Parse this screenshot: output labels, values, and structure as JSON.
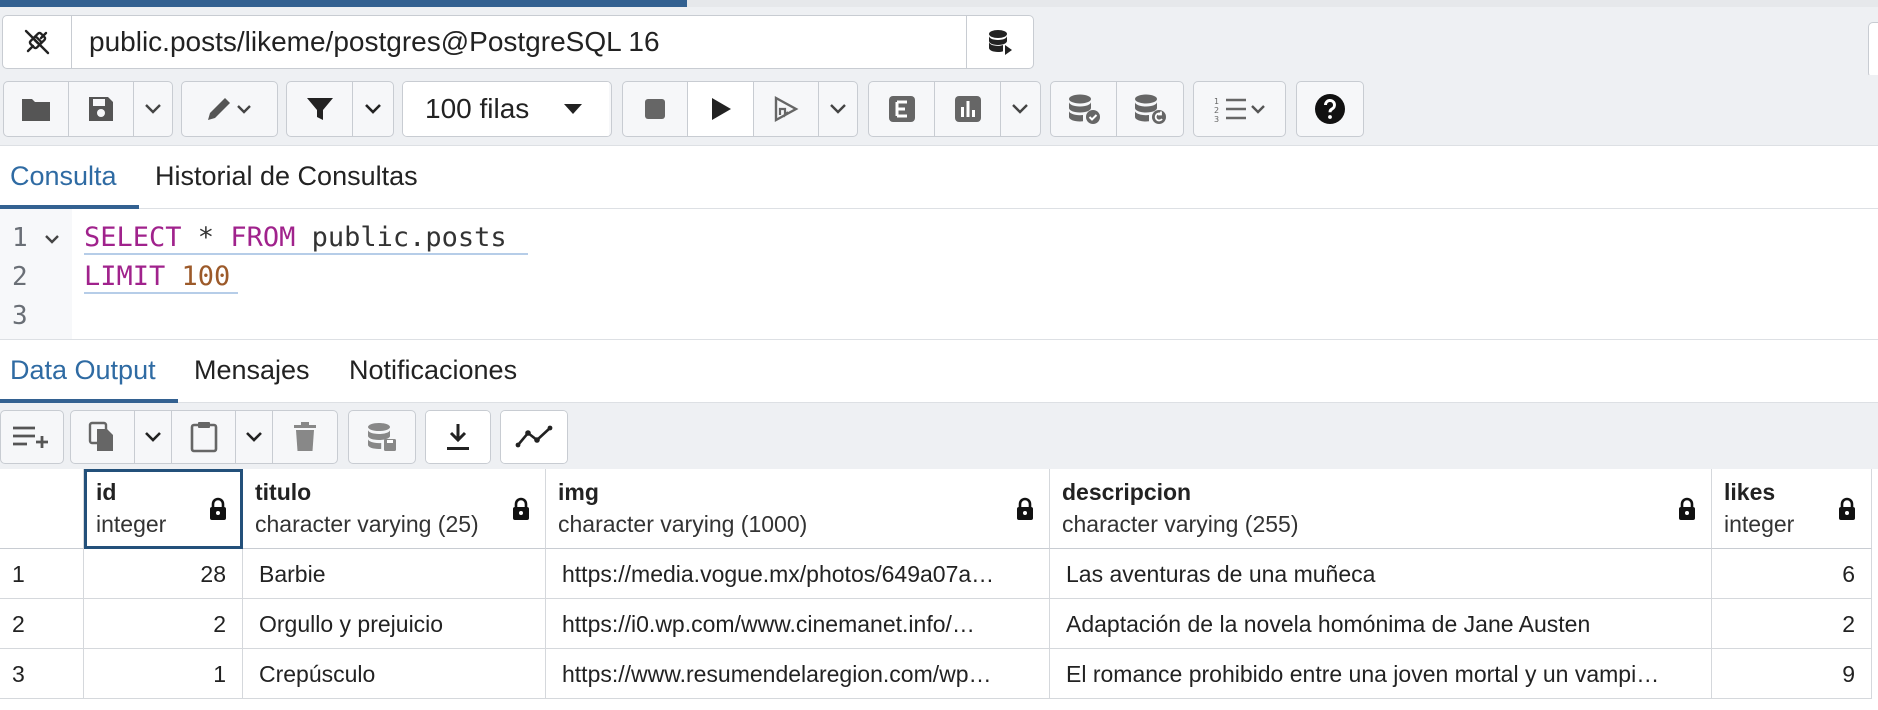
{
  "connection": {
    "label": "public.posts/likeme/postgres@PostgreSQL 16",
    "progress_fraction": 0.366
  },
  "toolbar": {
    "rows_limit_label": "100 filas"
  },
  "query_tabs": [
    {
      "label": "Consulta",
      "active": true
    },
    {
      "label": "Historial de Consultas",
      "active": false
    }
  ],
  "editor": {
    "line_numbers": [
      "1",
      "2",
      "3"
    ],
    "line1": {
      "kw1": "SELECT",
      "rest1": " * ",
      "kw2": "FROM",
      "rest2": " public.posts"
    },
    "line2": {
      "kw": "LIMIT",
      "num": " 100"
    }
  },
  "result_tabs": [
    {
      "label": "Data Output",
      "active": true
    },
    {
      "label": "Mensajes",
      "active": false
    },
    {
      "label": "Notificaciones",
      "active": false
    }
  ],
  "grid": {
    "columns": [
      {
        "name": "id",
        "type": "integer"
      },
      {
        "name": "titulo",
        "type": "character varying (25)"
      },
      {
        "name": "img",
        "type": "character varying (1000)"
      },
      {
        "name": "descripcion",
        "type": "character varying (255)"
      },
      {
        "name": "likes",
        "type": "integer"
      }
    ],
    "rows": [
      {
        "row": "1",
        "id": "28",
        "titulo": "Barbie",
        "img": "https://media.vogue.mx/photos/649a07a…",
        "descripcion": "Las aventuras de una muñeca",
        "likes": "6"
      },
      {
        "row": "2",
        "id": "2",
        "titulo": "Orgullo y prejuicio",
        "img": "https://i0.wp.com/www.cinemanet.info/…",
        "descripcion": "Adaptación de la novela homónima de Jane Austen",
        "likes": "2"
      },
      {
        "row": "3",
        "id": "1",
        "titulo": "Crepúsculo",
        "img": "https://www.resumendelaregion.com/wp…",
        "descripcion": "El romance prohibido entre una joven mortal y un vampi…",
        "likes": "9"
      }
    ]
  },
  "colors": {
    "accent": "#336191",
    "active_tab_text": "#2f6ba3",
    "keyword": "#a0228c",
    "number": "#9c5a2a"
  },
  "icons": {
    "connection": "disconnect-plug-icon",
    "db_switch": "database-arrow-icon",
    "open": "folder-icon",
    "save": "save-icon",
    "edit": "pencil-icon",
    "filter": "filter-icon",
    "stop": "stop-icon",
    "execute": "play-icon",
    "explain": "explain-e-icon",
    "analyze": "bar-chart-icon",
    "commit": "database-check-icon",
    "rollback": "database-undo-icon",
    "macros": "numbered-list-icon",
    "help": "help-icon",
    "add_row": "add-row-icon",
    "copy": "copy-icon",
    "paste": "paste-icon",
    "delete": "trash-icon",
    "save_data": "database-save-icon",
    "download": "download-icon",
    "graph": "line-graph-icon",
    "lock": "lock-icon"
  }
}
